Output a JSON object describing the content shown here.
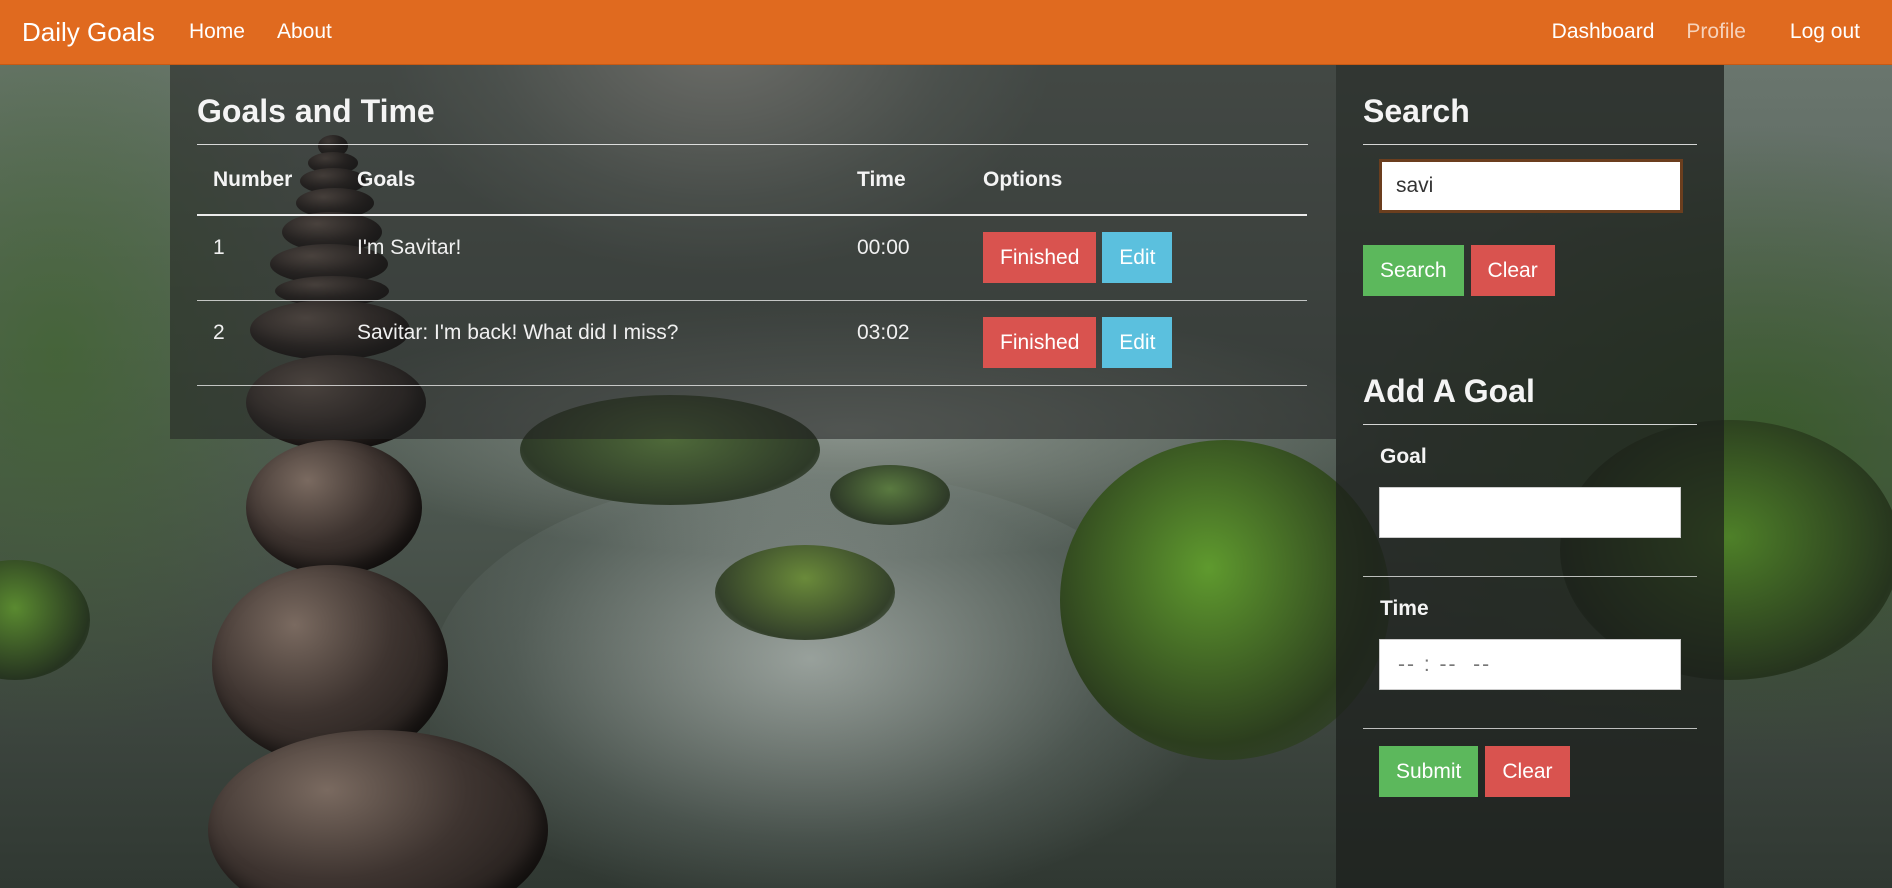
{
  "navbar": {
    "brand": "Daily Goals",
    "left_links": [
      "Home",
      "About"
    ],
    "right_links": [
      "Dashboard",
      "Profile",
      "Log out"
    ],
    "color": "#e06a1f"
  },
  "goals": {
    "title": "Goals and Time",
    "columns": [
      "Number",
      "Goals",
      "Time",
      "Options"
    ],
    "rows": [
      {
        "number": "1",
        "goal": "I'm Savitar!",
        "time": "00:00",
        "finished_label": "Finished",
        "edit_label": "Edit"
      },
      {
        "number": "2",
        "goal": "Savitar: I'm back! What did I miss?",
        "time": "03:02",
        "finished_label": "Finished",
        "edit_label": "Edit"
      }
    ]
  },
  "search": {
    "title": "Search",
    "input_value": "savi",
    "search_label": "Search",
    "clear_label": "Clear"
  },
  "add_goal": {
    "title": "Add A Goal",
    "goal_label": "Goal",
    "goal_value": "",
    "time_label": "Time",
    "time_placeholder": "-- : --  --",
    "submit_label": "Submit",
    "clear_label": "Clear"
  },
  "colors": {
    "danger": "#d9534f",
    "info": "#5bc0de",
    "success": "#5cb85c"
  }
}
